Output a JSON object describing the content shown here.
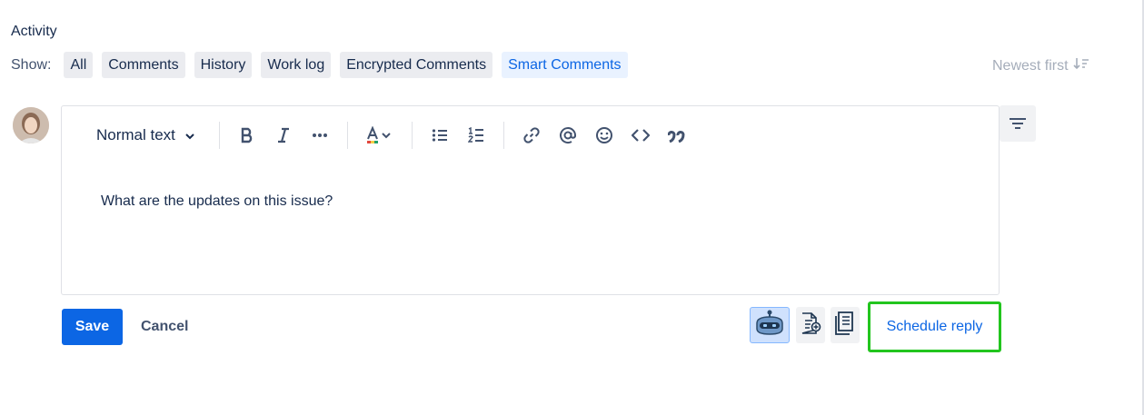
{
  "activity": {
    "title": "Activity",
    "show_label": "Show:",
    "filters": [
      {
        "label": "All",
        "selected": false
      },
      {
        "label": "Comments",
        "selected": false
      },
      {
        "label": "History",
        "selected": false
      },
      {
        "label": "Work log",
        "selected": false
      },
      {
        "label": "Encrypted Comments",
        "selected": false
      },
      {
        "label": "Smart Comments",
        "selected": true
      }
    ],
    "sort_label": "Newest first"
  },
  "editor": {
    "text_style": "Normal text",
    "content": "What are the updates on this issue?",
    "toolbar_icons": [
      "bold-icon",
      "italic-icon",
      "more-icon",
      "text-color-icon",
      "bullet-list-icon",
      "numbered-list-icon",
      "link-icon",
      "mention-icon",
      "emoji-icon",
      "code-icon",
      "quote-icon"
    ]
  },
  "actions": {
    "save_label": "Save",
    "cancel_label": "Cancel",
    "schedule_label": "Schedule reply"
  },
  "colors": {
    "primary": "#0c66e4",
    "selected_pill_bg": "#e9f2ff",
    "highlight_border": "#22c51e"
  }
}
